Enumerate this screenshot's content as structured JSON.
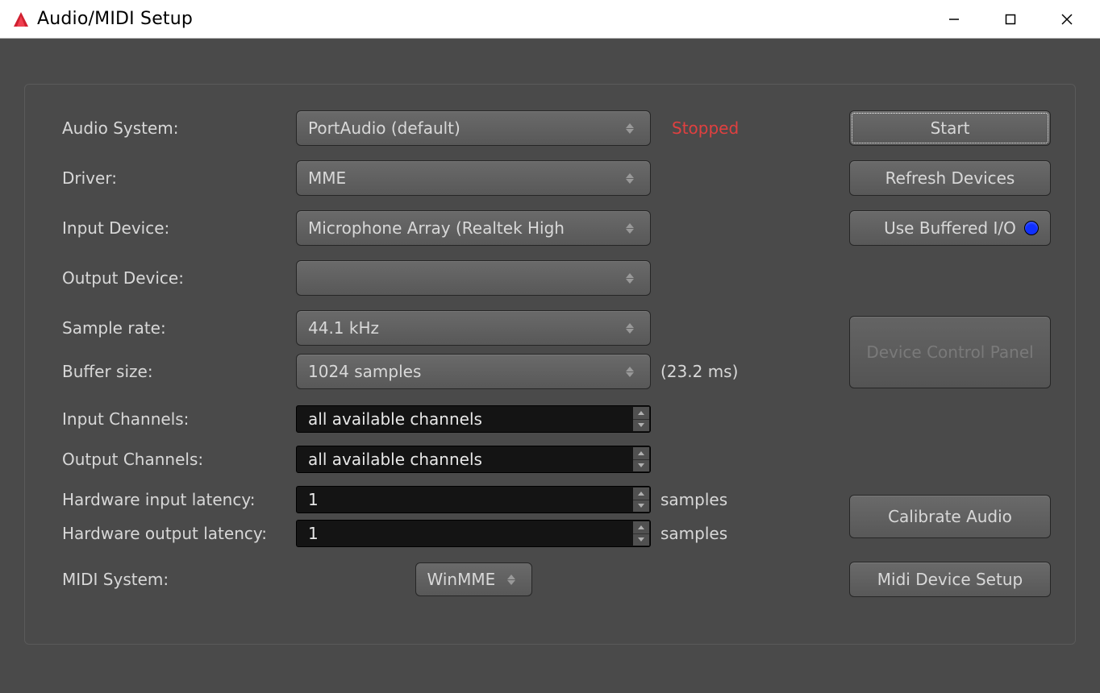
{
  "window": {
    "title": "Audio/MIDI Setup"
  },
  "labels": {
    "audio_system": "Audio System:",
    "driver": "Driver:",
    "input_device": "Input Device:",
    "output_device": "Output Device:",
    "sample_rate": "Sample rate:",
    "buffer_size": "Buffer size:",
    "input_channels": "Input Channels:",
    "output_channels": "Output Channels:",
    "hw_input_latency": "Hardware input latency:",
    "hw_output_latency": "Hardware output latency:",
    "midi_system": "MIDI System:"
  },
  "values": {
    "audio_system": "PortAudio (default)",
    "driver": "MME",
    "input_device": "Microphone Array (Realtek High",
    "output_device": "",
    "sample_rate": "44.1 kHz",
    "buffer_size": "1024 samples",
    "buffer_ms": "(23.2 ms)",
    "input_channels": "all available channels",
    "output_channels": "all available channels",
    "hw_input_latency": "1",
    "hw_output_latency": "1",
    "samples_unit": "samples",
    "midi_system": "WinMME"
  },
  "status": {
    "engine_state": "Stopped"
  },
  "buttons": {
    "start": "Start",
    "refresh": "Refresh Devices",
    "use_buffered": "Use Buffered I/O",
    "device_panel": "Device Control Panel",
    "calibrate": "Calibrate Audio",
    "midi_setup": "Midi Device Setup"
  }
}
